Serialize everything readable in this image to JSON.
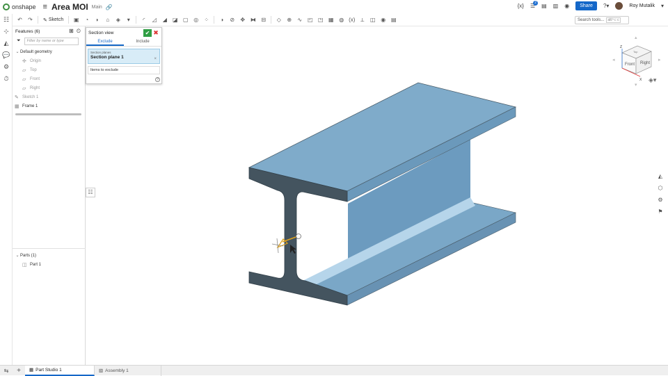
{
  "app": {
    "logo_text": "onshape",
    "doc_title": "Area MOI",
    "branch": "Main"
  },
  "topbar": {
    "share_label": "Share",
    "user_name": "Roy Mutalik",
    "notif_count": "2",
    "help_label": "?"
  },
  "toolbar": {
    "sketch_label": "Sketch",
    "search_placeholder": "Search tools...",
    "search_shortcut": "alt/⌥ c"
  },
  "feature_panel": {
    "title": "Features (6)",
    "filter_placeholder": "Filter by name or type",
    "default_geometry_label": "Default geometry",
    "geometry_items": [
      "Origin",
      "Top",
      "Front",
      "Right"
    ],
    "features": [
      "Sketch 1",
      "Frame 1"
    ],
    "parts_header": "Parts (1)",
    "parts": [
      "Part 1"
    ]
  },
  "section_view": {
    "title": "Section view",
    "tabs": [
      "Exclude",
      "Include"
    ],
    "active_tab": "Exclude",
    "planes_label": "Section planes",
    "plane_value": "Section plane 1",
    "exclude_label": "Items to exclude"
  },
  "viewcube": {
    "top": "Top",
    "front": "Front",
    "right": "Right",
    "z": "Z",
    "x": "X"
  },
  "bottom_tabs": [
    {
      "label": "Part Studio 1",
      "active": true
    },
    {
      "label": "Assembly 1",
      "active": false
    }
  ],
  "colors": {
    "model_face": "#7aa9c9",
    "model_dark": "#445560",
    "accent": "#1467c8",
    "ok": "#2f9e44"
  }
}
